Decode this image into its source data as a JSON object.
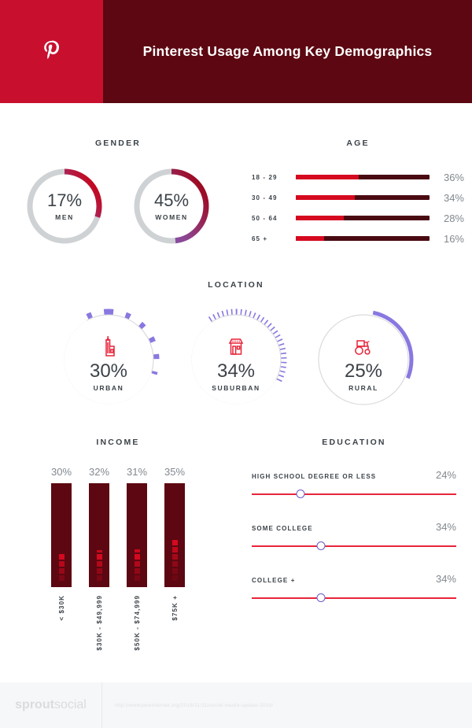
{
  "header": {
    "title": "Pinterest Usage Among Key Demographics",
    "logo_icon": "pinterest-icon",
    "logo_bg": "#c8102e",
    "title_bg": "#5c0711"
  },
  "gender": {
    "title": "GENDER",
    "items": [
      {
        "value": "17%",
        "label": "MEN",
        "pct": 17,
        "arc_pct": 30
      },
      {
        "value": "45%",
        "label": "WOMEN",
        "pct": 45,
        "arc_pct": 48
      }
    ]
  },
  "age": {
    "title": "AGE",
    "rows": [
      {
        "key": "18 - 29",
        "value": "36%",
        "pct": 36,
        "fill": 47
      },
      {
        "key": "30 - 49",
        "value": "34%",
        "pct": 34,
        "fill": 44
      },
      {
        "key": "50 - 64",
        "value": "28%",
        "pct": 28,
        "fill": 36
      },
      {
        "key": "65 +",
        "value": "16%",
        "pct": 16,
        "fill": 21
      }
    ]
  },
  "location": {
    "title": "LOCATION",
    "items": [
      {
        "value": "30%",
        "label": "URBAN",
        "pct": 30,
        "icon": "city-building-icon",
        "arc_style": "dotted"
      },
      {
        "value": "34%",
        "label": "SUBURBAN",
        "pct": 34,
        "icon": "storefront-icon",
        "arc_style": "dotted"
      },
      {
        "value": "25%",
        "label": "RURAL",
        "pct": 25,
        "icon": "tractor-icon",
        "arc_style": "solid"
      }
    ]
  },
  "income": {
    "title": "INCOME",
    "bars": [
      {
        "value": "30%",
        "key": "< $30K",
        "pct": 30,
        "squares": 4
      },
      {
        "value": "32%",
        "key": "$30K - $49,999",
        "pct": 32,
        "squares": 5
      },
      {
        "value": "31%",
        "key": "$50K - $74,999",
        "pct": 31,
        "squares": 5
      },
      {
        "value": "35%",
        "key": "$75K +",
        "pct": 35,
        "squares": 6
      }
    ]
  },
  "education": {
    "title": "EDUCATION",
    "rows": [
      {
        "key": "HIGH SCHOOL DEGREE OR LESS",
        "value": "24%",
        "pct": 24,
        "knob": 24
      },
      {
        "key": "SOME COLLEGE",
        "value": "34%",
        "pct": 34,
        "knob": 34
      },
      {
        "key": "COLLEGE +",
        "value": "34%",
        "pct": 34,
        "knob": 34
      }
    ]
  },
  "footer": {
    "brand_bold": "sprout",
    "brand_light": "social",
    "source_url": "http://www.pewinternet.org/2016/11/11/social-media-update-2016/"
  },
  "chart_data": [
    {
      "type": "pie",
      "title": "Gender",
      "categories": [
        "Men",
        "Women"
      ],
      "values": [
        17,
        45
      ],
      "unit": "%",
      "note": "Two separate donut gauges, each out of 100%"
    },
    {
      "type": "bar",
      "title": "Age",
      "orientation": "horizontal",
      "categories": [
        "18 - 29",
        "30 - 49",
        "50 - 64",
        "65 +"
      ],
      "values": [
        36,
        34,
        28,
        16
      ],
      "xlabel": "",
      "ylabel": "",
      "xlim": [
        0,
        100
      ],
      "unit": "%",
      "grid": false
    },
    {
      "type": "pie",
      "title": "Location",
      "categories": [
        "Urban",
        "Suburban",
        "Rural"
      ],
      "values": [
        30,
        34,
        25
      ],
      "unit": "%",
      "note": "Three donut gauges with icons"
    },
    {
      "type": "bar",
      "title": "Income",
      "orientation": "vertical",
      "categories": [
        "< $30K",
        "$30K - $49,999",
        "$50K - $74,999",
        "$75K +"
      ],
      "values": [
        30,
        32,
        31,
        35
      ],
      "xlabel": "",
      "ylabel": "",
      "ylim": [
        0,
        100
      ],
      "unit": "%",
      "grid": false
    },
    {
      "type": "bar",
      "title": "Education",
      "orientation": "horizontal",
      "categories": [
        "High school degree or less",
        "Some college",
        "College +"
      ],
      "values": [
        24,
        34,
        34
      ],
      "xlabel": "",
      "ylabel": "",
      "xlim": [
        0,
        100
      ],
      "unit": "%",
      "grid": false,
      "note": "Rendered as slider tracks with circular knobs"
    }
  ]
}
